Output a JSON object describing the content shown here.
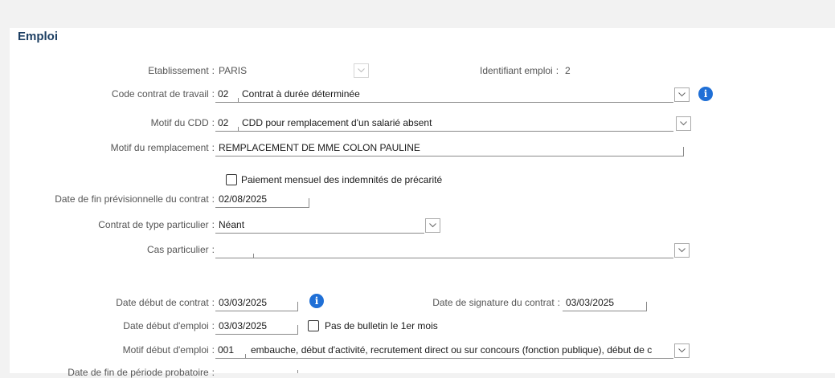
{
  "section_title": "Emploi",
  "etablissement": {
    "label": "Etablissement",
    "value": "PARIS"
  },
  "identifiant": {
    "label": "Identifiant emploi",
    "value": "2"
  },
  "code_contrat": {
    "label": "Code contrat de travail",
    "code": "02",
    "value": "Contrat à durée déterminée"
  },
  "motif_cdd": {
    "label": "Motif du CDD",
    "code": "02",
    "value": "CDD pour remplacement d'un salarié absent"
  },
  "motif_remplacement": {
    "label": "Motif du remplacement",
    "value": "REMPLACEMENT DE MME COLON PAULINE"
  },
  "paiement_precarite": {
    "label": "Paiement mensuel des indemnités de précarité",
    "checked": false
  },
  "date_fin_previsionnelle": {
    "label": "Date de fin prévisionnelle du contrat",
    "value": "02/08/2025"
  },
  "contrat_particulier": {
    "label": "Contrat de type particulier",
    "value": "Néant"
  },
  "cas_particulier": {
    "label": "Cas particulier",
    "value": ""
  },
  "date_debut_contrat": {
    "label": "Date début de contrat",
    "value": "03/03/2025"
  },
  "date_signature": {
    "label": "Date de signature du contrat",
    "value": "03/03/2025"
  },
  "date_debut_emploi": {
    "label": "Date début d'emploi",
    "value": "03/03/2025"
  },
  "pas_bulletin": {
    "label": "Pas de bulletin le 1er mois",
    "checked": false
  },
  "motif_debut_emploi": {
    "label": "Motif début d'emploi",
    "code": "001",
    "value": "embauche, début d'activité, recrutement direct ou sur concours (fonction publique), début de c"
  },
  "date_fin_probatoire": {
    "label": "Date de fin de période probatoire"
  },
  "icons": {
    "info": "info-icon",
    "dropdown": "chevron-down-icon"
  },
  "colors": {
    "title": "#1d3f63",
    "info": "#1f6fd6"
  }
}
